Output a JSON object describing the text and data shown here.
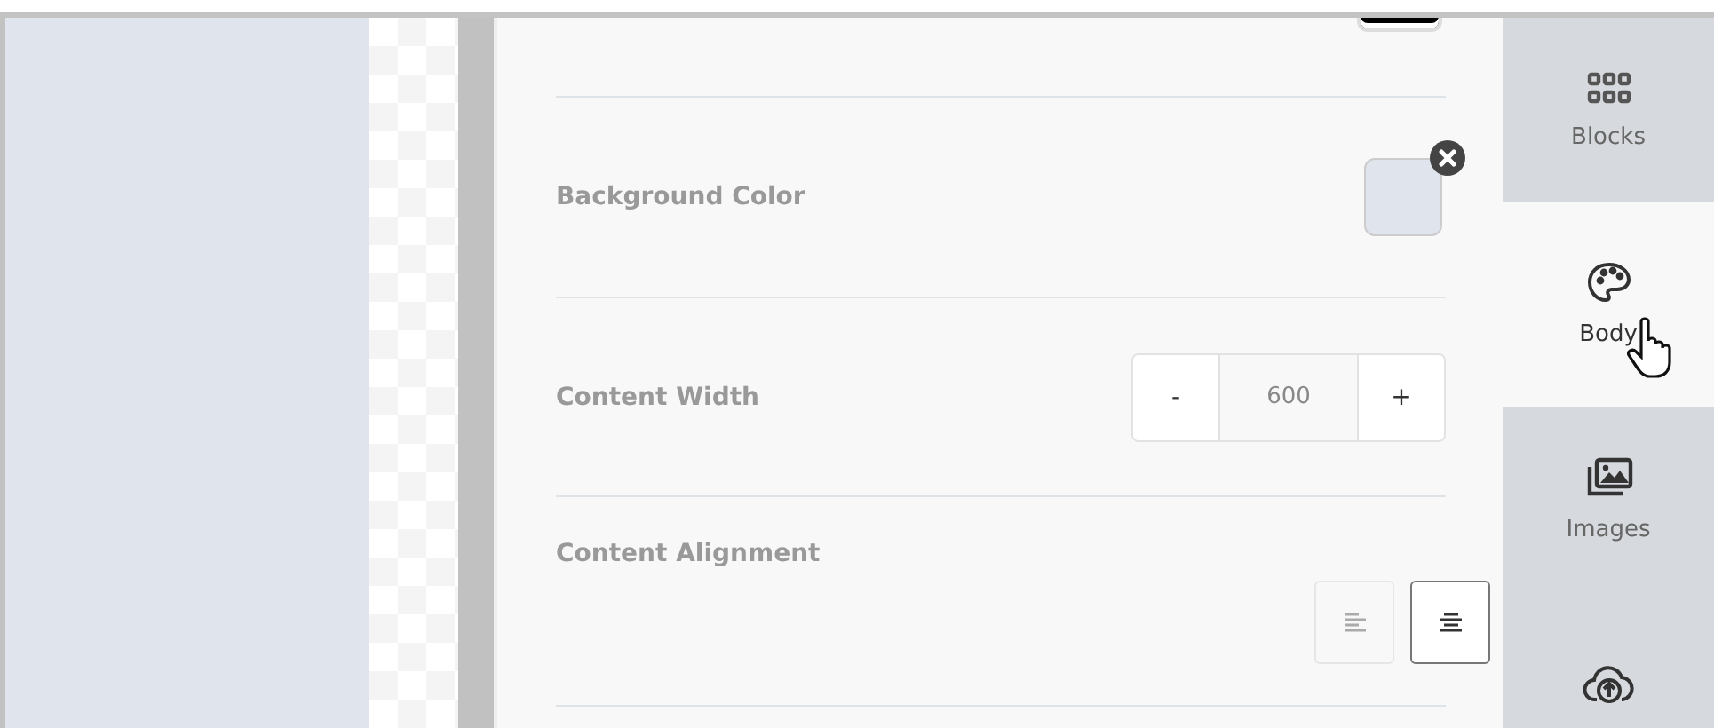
{
  "settings": [
    {
      "kind": "color",
      "label": "Background Color",
      "color": "#e0e4ec"
    },
    {
      "kind": "stepper",
      "label": "Content Width",
      "minus": "-",
      "value": "600",
      "plus": "+"
    },
    {
      "kind": "align",
      "label": "Content Alignment",
      "options": [
        {
          "kind": "left",
          "selected": false
        },
        {
          "kind": "center",
          "selected": true
        }
      ]
    }
  ],
  "tabs": [
    {
      "kind": "grid",
      "label": "Blocks",
      "selected": false
    },
    {
      "kind": "palette",
      "label": "Body",
      "selected": true
    },
    {
      "kind": "images",
      "label": "Images",
      "selected": false
    },
    {
      "kind": "upload",
      "selected": false
    }
  ]
}
